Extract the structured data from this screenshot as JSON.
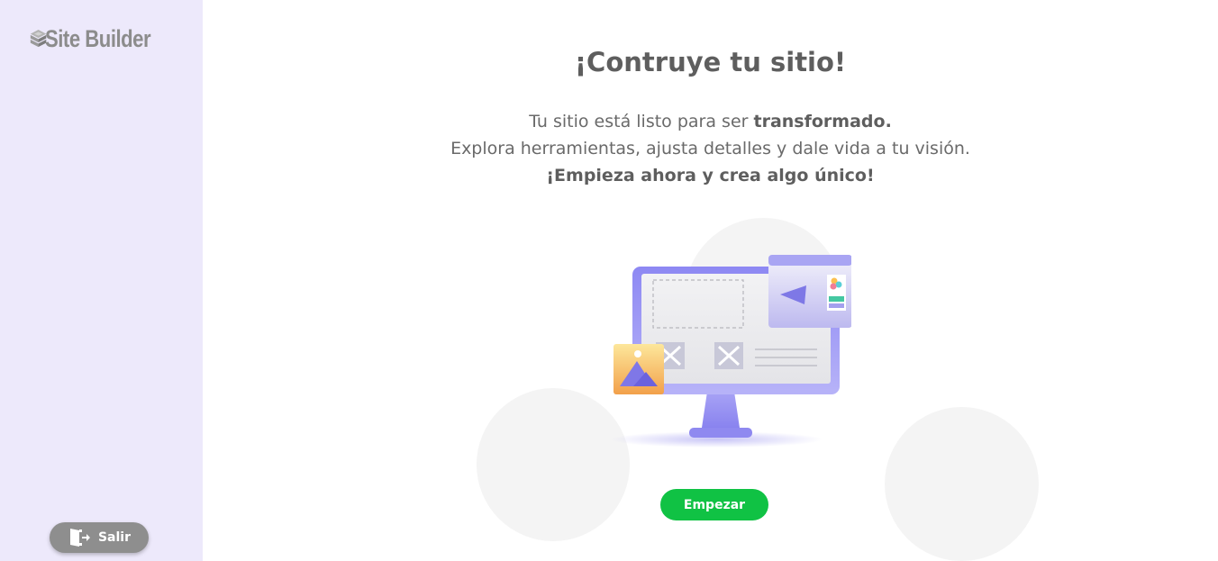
{
  "sidebar": {
    "logo_text": "Site Builder",
    "logout_label": "Salir"
  },
  "main": {
    "title": "¡Contruye tu sitio!",
    "line1_prefix": "Tu sitio está listo para ser ",
    "line1_bold": "transformado.",
    "line2": "Explora herramientas, ajusta detalles y dale vida a tu visión.",
    "line3": "¡Empieza ahora y crea algo único!",
    "start_button": "Empezar"
  },
  "colors": {
    "sidebar_bg": "#ede9fb",
    "accent_green": "#10c244",
    "logout_bg": "#8e8e8e",
    "monitor": "#8b86f0"
  },
  "icons": [
    "site-builder-logo-icon",
    "logout-door-icon",
    "website-building-illustration"
  ]
}
